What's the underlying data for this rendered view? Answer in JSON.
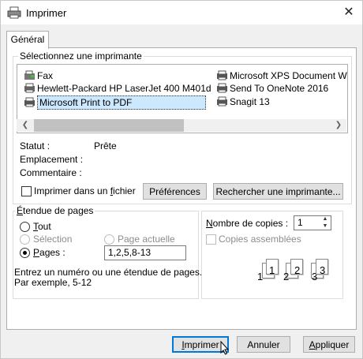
{
  "window": {
    "title": "Imprimer"
  },
  "tabs": [
    {
      "label": "Général"
    }
  ],
  "printer_group": {
    "legend": "Sélectionnez une imprimante",
    "printers": [
      {
        "name": "Fax"
      },
      {
        "name": "Hewlett-Packard HP LaserJet 400 M401d"
      },
      {
        "name": "Microsoft Print to PDF",
        "selected": true
      },
      {
        "name": "Microsoft XPS Document W"
      },
      {
        "name": "Send To OneNote 2016"
      },
      {
        "name": "Snagit 13"
      }
    ]
  },
  "status": {
    "statut_label": "Statut :",
    "statut_value": "Prête",
    "emplacement_label": "Emplacement :",
    "commentaire_label": "Commentaire :"
  },
  "print_to_file": {
    "label_pre": "Imprimer dans un ",
    "label_accel": "f",
    "label_post": "ichier",
    "checked": false
  },
  "buttons": {
    "preferences": "Préférences",
    "find_printer": "Rechercher une imprimante...",
    "print_accel": "I",
    "print_rest": "mprimer",
    "cancel": "Annuler",
    "apply_accel": "A",
    "apply_rest": "ppliquer"
  },
  "page_range": {
    "legend_accel": "É",
    "legend_rest": "tendue de pages",
    "all_accel": "T",
    "all_rest": "out",
    "selection_label": "Sélection",
    "current_page_label": "Page actuelle",
    "pages_accel": "P",
    "pages_rest": "ages :",
    "pages_value": "1,2,5,8-13",
    "hint_line1": "Entrez un numéro ou une étendue de pages.",
    "hint_line2": "Par exemple, 5-12"
  },
  "copies": {
    "label_accel": "N",
    "label_rest": "ombre de copies :",
    "value": "1",
    "collate_label": "Copies assemblées",
    "collate_checked": false,
    "collate_pages": [
      "1",
      "1",
      "2",
      "2",
      "3",
      "3"
    ]
  },
  "colors": {
    "accent": "#0078d7",
    "selection_bg": "#cce8ff"
  }
}
